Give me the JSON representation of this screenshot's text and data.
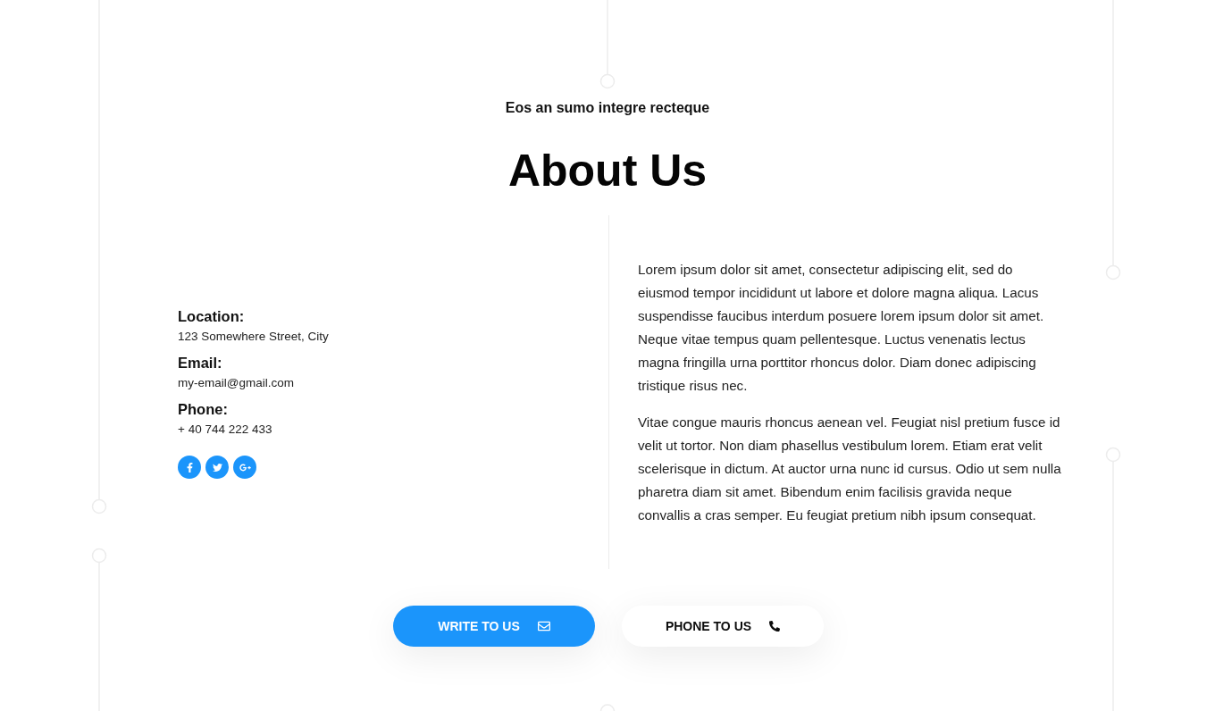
{
  "header": {
    "eyebrow": "Eos an sumo integre recteque",
    "title": "About Us"
  },
  "contact": {
    "items": [
      {
        "label": "Location:",
        "value": "123 Somewhere Street, City"
      },
      {
        "label": "Email:",
        "value": "my-email@gmail.com"
      },
      {
        "label": "Phone:",
        "value": "+ 40 744 222 433"
      }
    ],
    "social": [
      {
        "kind": "facebook"
      },
      {
        "kind": "twitter"
      },
      {
        "kind": "googleplus"
      }
    ]
  },
  "paragraphs": [
    "Lorem ipsum dolor sit amet, consectetur adipiscing elit, sed do eiusmod tempor incididunt ut labore et dolore magna aliqua. Lacus suspendisse faucibus interdum posuere lorem ipsum dolor sit amet. Neque vitae tempus quam pellentesque. Luctus venenatis lectus magna fringilla urna porttitor rhoncus dolor. Diam donec adipiscing tristique risus nec.",
    "Vitae congue mauris rhoncus aenean vel. Feugiat nisl pretium fusce id velit ut tortor. Non diam phasellus vestibulum lorem. Etiam erat velit scelerisque in dictum. At auctor urna nunc id cursus. Odio ut sem nulla pharetra diam sit amet. Bibendum enim facilisis gravida neque convallis a cras semper. Eu feugiat pretium nibh ipsum consequat."
  ],
  "buttons": [
    {
      "label": "WRITE TO US",
      "kind": "email"
    },
    {
      "label": "PHONE TO US",
      "kind": "phone"
    }
  ]
}
